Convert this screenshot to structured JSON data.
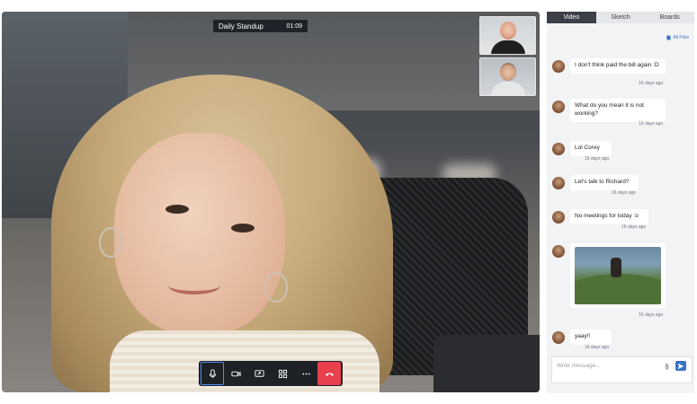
{
  "call": {
    "title": "Daily Standup",
    "timer": "01:09"
  },
  "controls": [
    {
      "icon": "microphone-icon",
      "active": true
    },
    {
      "icon": "video-camera-icon",
      "active": false
    },
    {
      "icon": "screen-share-icon",
      "active": false
    },
    {
      "icon": "grid-icon",
      "active": false
    },
    {
      "icon": "more-icon",
      "active": false
    },
    {
      "icon": "end-call-icon",
      "active": false
    }
  ],
  "panel": {
    "tabs": [
      {
        "label": "Video",
        "active": true
      },
      {
        "label": "Sketch",
        "active": false
      },
      {
        "label": "Boards",
        "active": false
      }
    ],
    "all_files": "All Files",
    "messages": [
      {
        "text": "I don't think paid the bill again :D",
        "time": "16 days ago"
      },
      {
        "text": "What do you mean it is not working?",
        "time": "16 days ago"
      },
      {
        "text": "Lol Corey",
        "time": "16 days ago"
      },
      {
        "text": "Let's talk to Richard?",
        "time": "16 days ago"
      },
      {
        "text": "No meetings for today :o",
        "time": "16 days ago"
      },
      {
        "text": "",
        "time": "16 days ago",
        "image": true
      },
      {
        "text": "yaay!!",
        "time": "16 days ago"
      }
    ],
    "compose_placeholder": "Write message..."
  },
  "colors": {
    "accent": "#3873c8",
    "end_call": "#e8404d",
    "toolbar_bg": "#1e2126"
  }
}
